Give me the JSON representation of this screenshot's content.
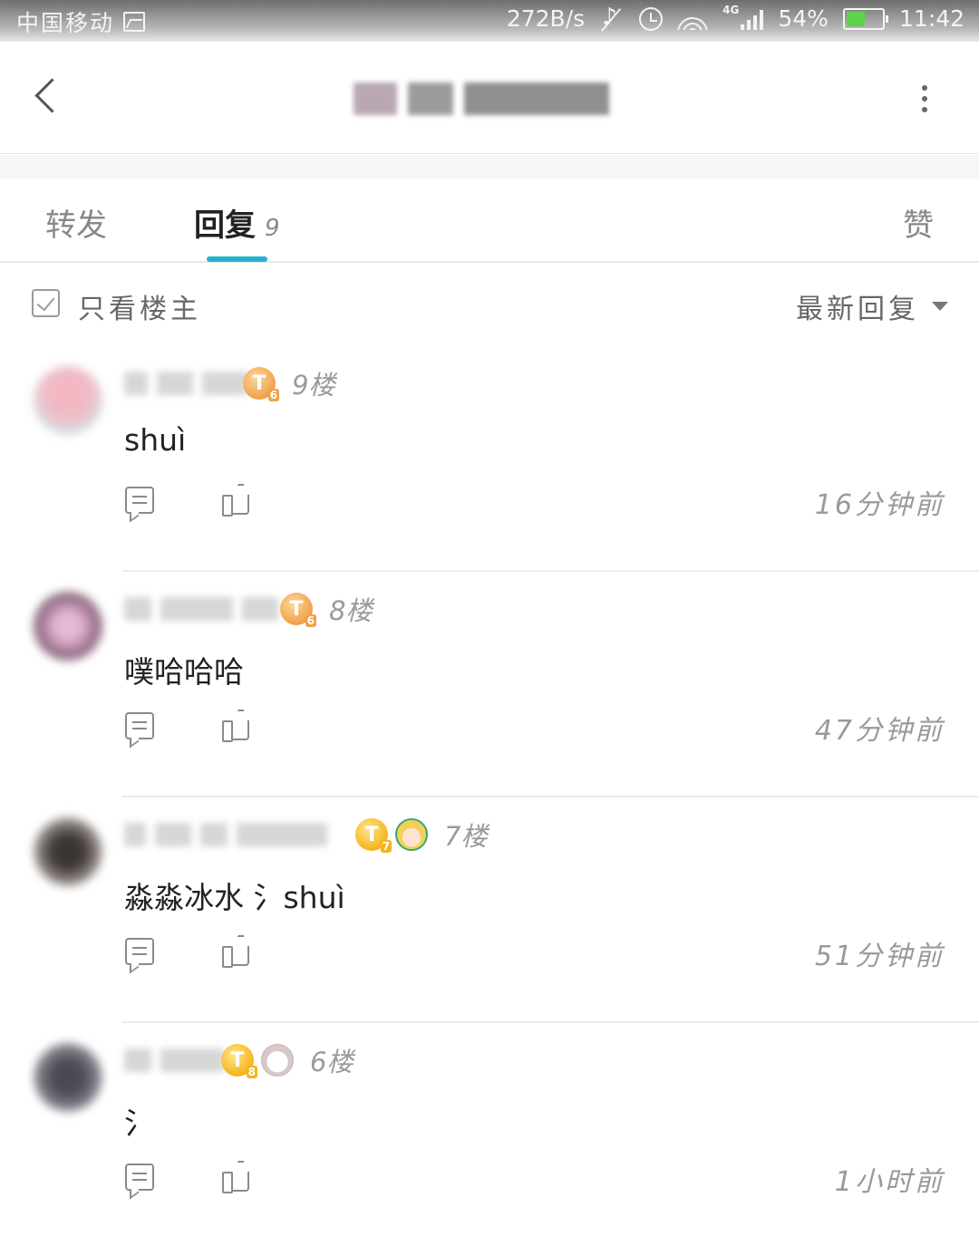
{
  "status_bar": {
    "carrier": "中国移动",
    "speed": "272B/s",
    "network": "4G",
    "battery": "54%",
    "battery_level": 0.54,
    "time": "11:42"
  },
  "tabs": {
    "repost": "转发",
    "reply": "回复",
    "reply_count": "9",
    "like": "赞",
    "active": "reply",
    "accent": "#23b3cf"
  },
  "filter": {
    "only_op": "只看楼主",
    "sort": "最新回复"
  },
  "comments": [
    {
      "floor": "9楼",
      "level_badge": "T",
      "level_num": "6",
      "content": "shuì",
      "time": "16分钟前",
      "sticker": ""
    },
    {
      "floor": "8楼",
      "level_badge": "T",
      "level_num": "6",
      "content": "噗哈哈哈",
      "time": "47分钟前",
      "sticker": ""
    },
    {
      "floor": "7楼",
      "level_badge": "T",
      "level_num": "7",
      "content": "淼淼冰水 氵shuì",
      "time": "51分钟前",
      "sticker": "anime-girl-sticker"
    },
    {
      "floor": "6楼",
      "level_badge": "T",
      "level_num": "8",
      "content": "氵",
      "time": "1小时前",
      "sticker": "bunny-sticker"
    }
  ],
  "icons": [
    "back-icon",
    "more-vert-icon",
    "checkbox-icon",
    "dropdown-caret-icon",
    "comment-icon",
    "thumb-up-icon"
  ]
}
